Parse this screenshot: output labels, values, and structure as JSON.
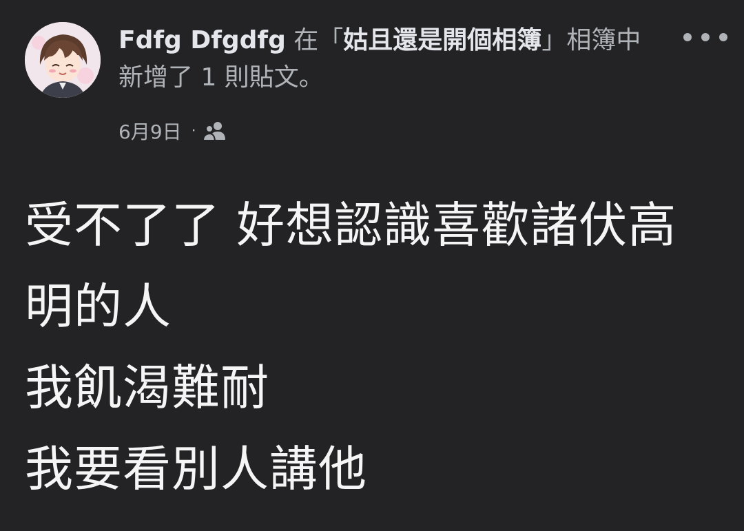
{
  "post": {
    "author": "Fdfg Dfgdfg",
    "action_prefix": " 在「",
    "album": "姑且還是開個相簿",
    "action_suffix": "」相簿中新增了 1 則貼文。",
    "date": "6月9日",
    "separator": "·",
    "audience_icon": "friends-icon",
    "more_icon": "more-options-icon",
    "body_lines": [
      "受不了了 好想認識喜歡諸伏高",
      "明的人",
      "我飢渴難耐",
      "我要看別人講他"
    ]
  },
  "colors": {
    "background": "#232325",
    "primary_text": "#e4e6eb",
    "secondary_text": "#b0b3b8"
  }
}
